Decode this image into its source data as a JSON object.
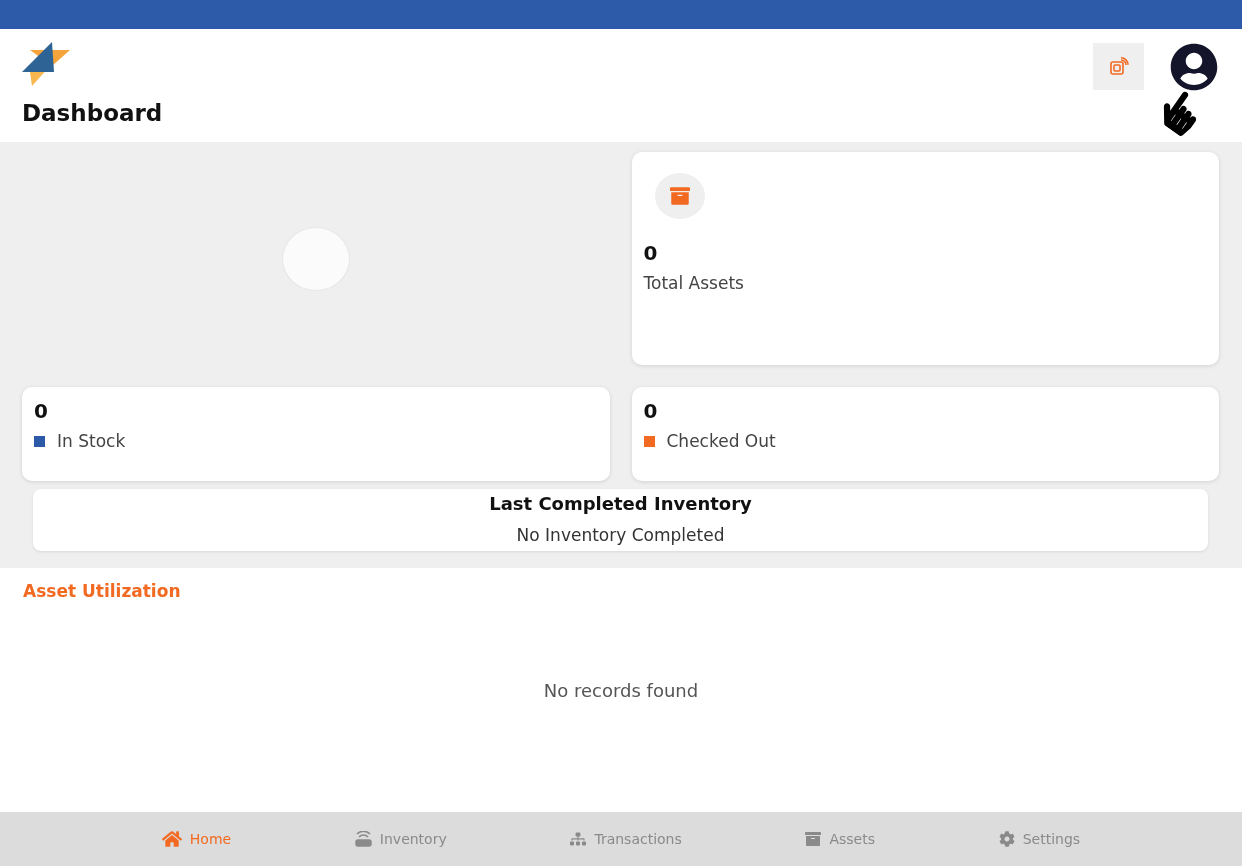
{
  "header": {
    "title": "Dashboard"
  },
  "total_assets": {
    "value": "0",
    "label": "Total Assets"
  },
  "stats": [
    {
      "value": "0",
      "label": "In Stock",
      "color": "#2d5aa8"
    },
    {
      "value": "0",
      "label": "Checked Out",
      "color": "#f26a22"
    }
  ],
  "last_inventory": {
    "title": "Last Completed Inventory",
    "message": "No Inventory Completed"
  },
  "utilization": {
    "title": "Asset Utilization",
    "empty": "No records found"
  },
  "nav": [
    {
      "label": "Home",
      "kind": "home",
      "selected": true
    },
    {
      "label": "Inventory",
      "kind": "inventory",
      "selected": false
    },
    {
      "label": "Transactions",
      "kind": "transactions",
      "selected": false
    },
    {
      "label": "Assets",
      "kind": "assets",
      "selected": false
    },
    {
      "label": "Settings",
      "kind": "settings",
      "selected": false
    }
  ]
}
